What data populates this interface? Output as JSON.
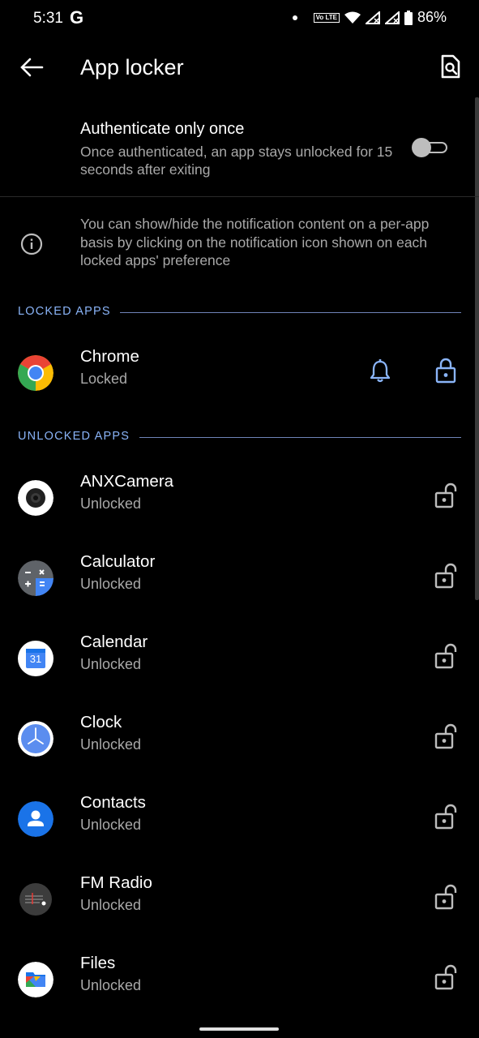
{
  "status_bar": {
    "time": "5:31",
    "g_label": "G",
    "volte": "Vo LTE",
    "battery": "86%"
  },
  "app_bar": {
    "title": "App locker",
    "back_icon": "arrow-back-icon",
    "search_icon": "search-in-page-icon"
  },
  "auth_setting": {
    "title": "Authenticate only once",
    "description": "Once authenticated, an app stays unlocked for 15 seconds after exiting",
    "enabled": false
  },
  "info": {
    "text": "You can show/hide the notification content on a per-app basis by clicking on the notification icon shown on each locked apps' preference"
  },
  "locked_section": {
    "label": "LOCKED APPS"
  },
  "unlocked_section": {
    "label": "UNLOCKED APPS"
  },
  "locked_apps": [
    {
      "name": "Chrome",
      "status": "Locked"
    }
  ],
  "unlocked_apps": [
    {
      "name": "ANXCamera",
      "status": "Unlocked"
    },
    {
      "name": "Calculator",
      "status": "Unlocked"
    },
    {
      "name": "Calendar",
      "status": "Unlocked",
      "icon_text": "31"
    },
    {
      "name": "Clock",
      "status": "Unlocked"
    },
    {
      "name": "Contacts",
      "status": "Unlocked"
    },
    {
      "name": "FM Radio",
      "status": "Unlocked"
    },
    {
      "name": "Files",
      "status": "Unlocked"
    }
  ],
  "colors": {
    "accent": "#8ab4f8",
    "secondary_text": "#a8a8a8",
    "background": "#000000"
  }
}
